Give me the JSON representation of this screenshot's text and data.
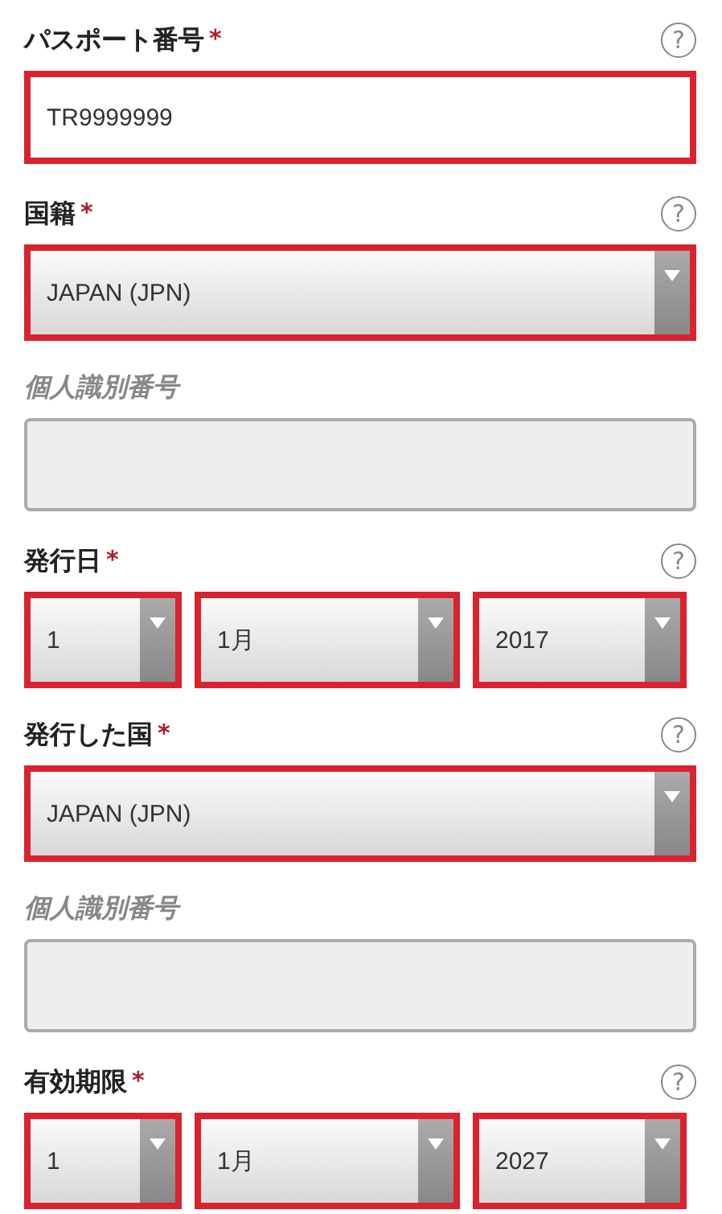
{
  "fields": [
    {
      "kind": "text",
      "label": "パスポート番号",
      "required_mark": "*",
      "help": "?",
      "invalid": true,
      "value": "TR9999999"
    },
    {
      "kind": "select",
      "label": "国籍",
      "required_mark": "*",
      "help": "?",
      "invalid": true,
      "value": "JAPAN (JPN)"
    },
    {
      "kind": "text",
      "label": "個人識別番号",
      "invalid": false
    },
    {
      "kind": "date",
      "label": "発行日",
      "required_mark": "*",
      "help": "?",
      "invalid": true,
      "parts": [
        "1",
        "1月",
        "2017"
      ]
    },
    {
      "kind": "select",
      "label": "発行した国",
      "required_mark": "*",
      "help": "?",
      "invalid": true,
      "value": "JAPAN (JPN)"
    },
    {
      "kind": "text",
      "label": "個人識別番号",
      "invalid": false
    },
    {
      "kind": "date",
      "label": "有効期限",
      "required_mark": "*",
      "help": "?",
      "invalid": true,
      "parts": [
        "1",
        "1月",
        "2027"
      ]
    }
  ]
}
